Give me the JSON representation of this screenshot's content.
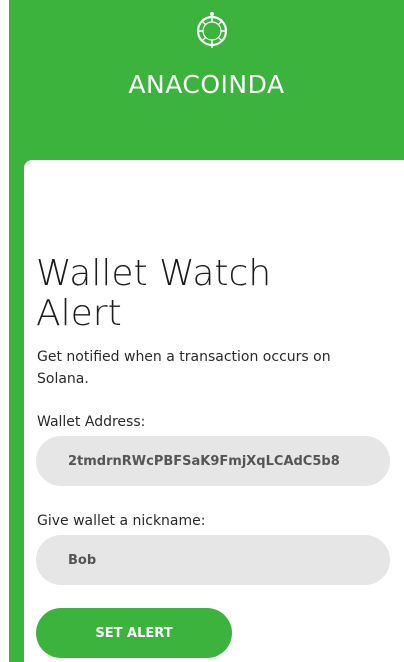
{
  "brand": {
    "name": "ANACOINDA",
    "logo_icon": "crystal-ring-icon",
    "brand_color": "#3cb33c"
  },
  "form": {
    "title": "Wallet Watch Alert",
    "subtitle": "Get notified when a transaction occurs on Solana.",
    "wallet_label": "Wallet Address:",
    "wallet_value": "2tmdrnRWcPBFSaK9FmjXqLCAdC5b8",
    "nickname_label": "Give wallet a nickname:",
    "nickname_value": "Bob",
    "submit_label": "SET ALERT"
  }
}
